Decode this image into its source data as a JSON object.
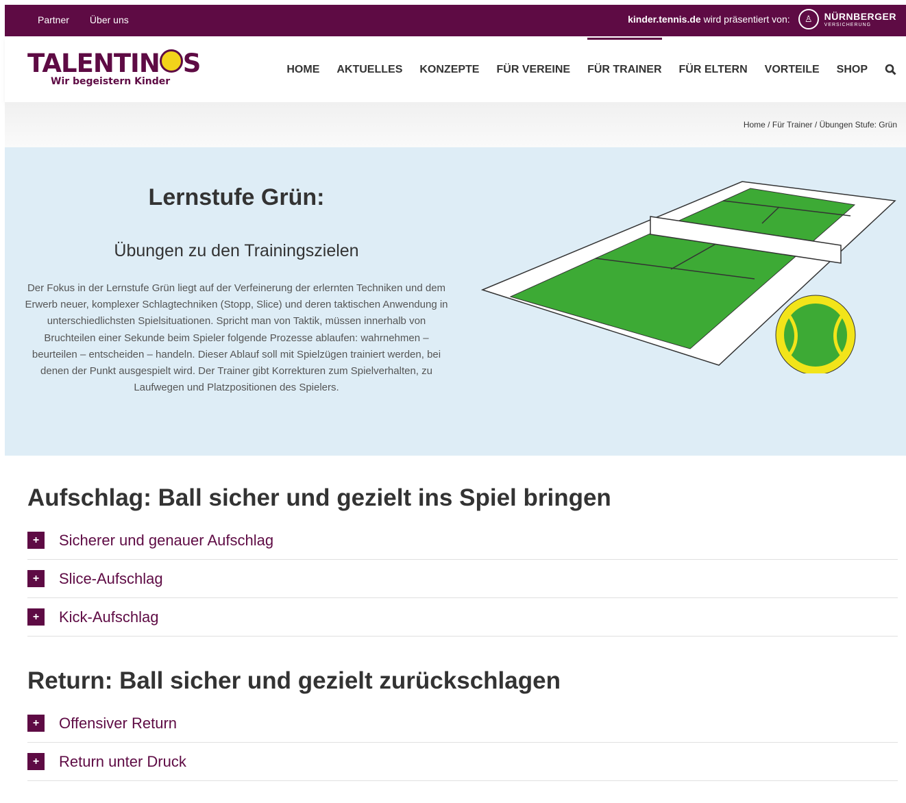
{
  "topbar": {
    "links": [
      "Partner",
      "Über uns"
    ],
    "domain": "kinder.tennis.de",
    "presented": "wird präsentiert von:",
    "sponsor_name": "NÜRNBERGER",
    "sponsor_sub": "VERSICHERUNG"
  },
  "logo": {
    "word_start": "TALENTIN",
    "word_end": "S",
    "tagline": "Wir begeistern Kinder"
  },
  "nav": {
    "items": [
      "HOME",
      "AKTUELLES",
      "KONZEPTE",
      "FÜR VEREINE",
      "FÜR TRAINER",
      "FÜR ELTERN",
      "VORTEILE",
      "SHOP"
    ],
    "active": "FÜR TRAINER",
    "search_icon": "search-icon"
  },
  "breadcrumb": {
    "items": [
      "Home",
      "Für Trainer",
      "Übungen Stufe: Grün"
    ],
    "separator": "/"
  },
  "hero": {
    "title": "Lernstufe Grün:",
    "subtitle": "Übungen zu den Trainingszielen",
    "text": "Der Fokus in der Lernstufe Grün liegt auf der Verfeinerung der erlernten Techniken und dem Erwerb neuer, komplexer Schlagtechniken (Stopp, Slice) und deren taktischen Anwendung in unterschiedlichsten Spielsituationen. Spricht man von Taktik, müssen innerhalb von Bruchteilen einer Sekunde beim Spieler folgende Prozesse ablaufen: wahrnehmen – beurteilen – entscheiden – handeln. Dieser Ablauf soll mit Spielzügen trainiert werden, bei denen der Punkt ausgespielt wird. Der Trainer gibt Korrekturen zum Spielverhalten, zu Laufwegen und Platzpositionen des Spielers."
  },
  "sections": [
    {
      "title": "Aufschlag: Ball sicher und gezielt ins Spiel bringen",
      "items": [
        "Sicherer und genauer Aufschlag",
        "Slice-Aufschlag",
        "Kick-Aufschlag"
      ]
    },
    {
      "title": "Return: Ball sicher und gezielt zurückschlagen",
      "items": [
        "Offensiver Return",
        "Return unter Druck"
      ]
    }
  ],
  "colors": {
    "brand": "#5e0b44",
    "hero_bg": "#deedf6",
    "court_green": "#3daa35",
    "ball_yellow": "#f2e41a"
  }
}
